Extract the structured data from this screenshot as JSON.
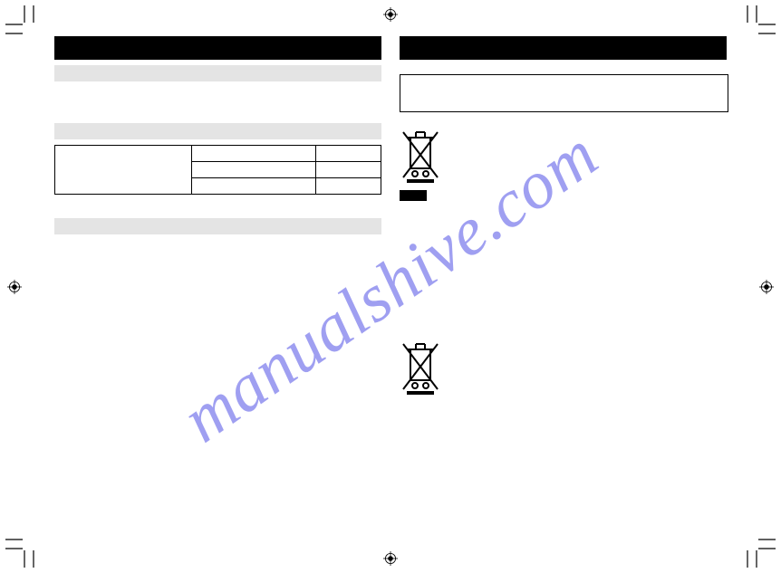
{
  "watermark": "manualshive.com",
  "left_column": {
    "header_bar": "",
    "grey_bar_1": "",
    "grey_bar_2": "",
    "table": {
      "rows": [
        {
          "c1": "",
          "c2": "",
          "c3": ""
        },
        {
          "c1": "",
          "c2": "",
          "c3": ""
        },
        {
          "c1": "",
          "c2": "",
          "c3": ""
        }
      ]
    },
    "grey_bar_3": ""
  },
  "right_column": {
    "header_bar": "",
    "outlined_box": "",
    "weee_1_label": "",
    "black_chip": "",
    "weee_2_label": ""
  },
  "icons": {
    "weee": "weee-bin-icon",
    "registration": "registration-mark-icon",
    "crop": "crop-mark-icon"
  }
}
